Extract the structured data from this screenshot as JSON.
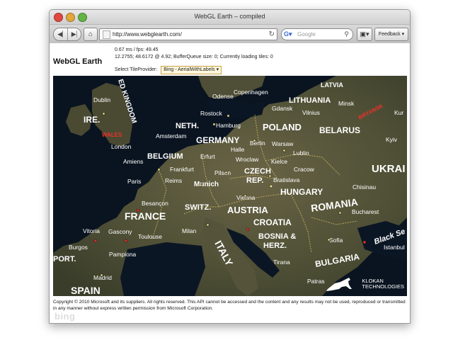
{
  "window": {
    "title": "WebGL Earth – compiled"
  },
  "toolbar": {
    "back_icon": "back-arrow-icon",
    "forward_icon": "forward-arrow-icon",
    "home_icon": "home-icon",
    "url": "http://www.webglearth.com/",
    "reload_icon": "reload-icon",
    "search_placeholder": "Google",
    "search_icon": "magnifier-icon",
    "bookmarks_icon": "bookmarks-icon",
    "feedback_label": "Feedback"
  },
  "app": {
    "title": "WebGL Earth",
    "stats_line1": "0.67 ms / fps: 49.45",
    "stats_line2": "12.2755; 48.6172 @ 4.92; BufferQueue size: 0; Currently loading tiles: 0",
    "tile_provider_label": "Select TileProvider:",
    "tile_provider_value": "Bing - AerialWithLabels"
  },
  "map": {
    "countries": [
      "ED KINGDOM",
      "IRE.",
      "NETH.",
      "GERMANY",
      "POLAND",
      "BELARUS",
      "BELGIUM",
      "CZECH",
      "REP.",
      "UKRAI",
      "FRANCE",
      "SWITZ.",
      "AUSTRIA",
      "HUNGARY",
      "ROMANIA",
      "CROATIA",
      "BOSNIA &",
      "HERZ.",
      "ITALY",
      "BULGARIA",
      "SPAIN",
      "PORT.",
      "LATVIA",
      "LITHUANIA",
      "WALES",
      "Black Se",
      "BRYANSK"
    ],
    "cities": [
      "Dublin",
      "Odense",
      "Copenhagen",
      "Rostock",
      "Gdansk",
      "Vilnius",
      "Minsk",
      "Hamburg",
      "Amsterdam",
      "London",
      "Berlin",
      "Warsaw",
      "Kyiv",
      "Erfurt",
      "Halle",
      "Wroclaw",
      "Lublin",
      "Amiens",
      "Frankfurt",
      "Kielce",
      "Cracow",
      "Paris",
      "Reims",
      "Pilsen",
      "Bratislava",
      "Munich",
      "Chisinau",
      "Vienna",
      "Besançon",
      "Bucharest",
      "Milan",
      "Vitoria",
      "Gascony",
      "Toulouse",
      "Sofia",
      "Burgos",
      "Pampiona",
      "Istanbul",
      "Tirana",
      "Madrid",
      "Patras",
      "Bryansk",
      "Kur"
    ],
    "logo_text_line1": "KLOKAN",
    "logo_text_line2": "TECHNOLOGIES"
  },
  "footer": {
    "copyright": "Copyright © 2010 Microsoft and its suppliers. All rights reserved. This API cannot be accessed and the content and any results may not be used, reproduced or transmitted in any manner without express written permission from Microsoft Corporation.",
    "bing_logo": "bing"
  },
  "colors": {
    "accent_border": "#c9a24a",
    "map_ocean": "#0a1420",
    "map_land": "#5c5a3e",
    "label_white": "#ffffff",
    "label_red": "#e8322b"
  }
}
